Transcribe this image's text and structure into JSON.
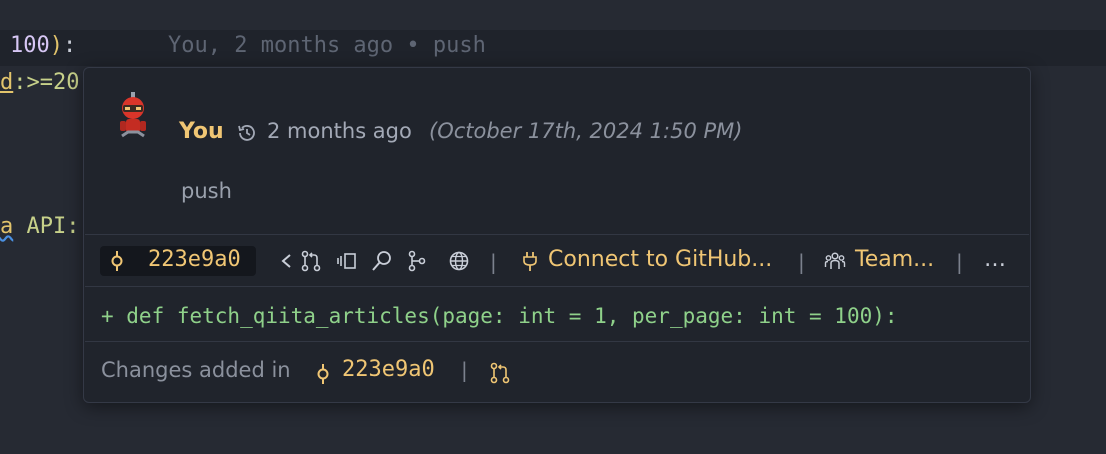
{
  "editor": {
    "line1_num": "100",
    "line1_close": ")",
    "line1_colon": ":",
    "line1_blame": "You, 2 months ago • push",
    "line2_prefix": "d",
    "line2_rest": ":>=20",
    "line3_prefix": "a",
    "line3_rest": " API:"
  },
  "hover": {
    "author": "You",
    "time_relative": "2 months ago",
    "time_absolute": "(October 17th, 2024 1:50 PM)",
    "message": "push",
    "sha": "223e9a0",
    "connect_label": "Connect to GitHub...",
    "team_label": "Team...",
    "more_label": "…",
    "separator": "|",
    "diff_line": "+ def fetch_qiita_articles(page: int = 1, per_page: int = 100):",
    "footer_text": "Changes added in",
    "footer_sha": "223e9a0"
  },
  "colors": {
    "accent": "#f0c674",
    "diff_added": "#8fd18a",
    "card_bg": "#20242c",
    "editor_bg": "#262a33"
  },
  "icons": {
    "avatar": "robot-avatar",
    "history": "history-icon",
    "commit": "git-commit-icon",
    "prev": "chevron-left-icon",
    "pr": "pull-request-icon",
    "changes": "open-changes-icon",
    "search": "search-icon",
    "graph": "commit-graph-icon",
    "web": "globe-icon",
    "plug": "plug-icon",
    "team": "team-icon",
    "more": "more-icon"
  }
}
